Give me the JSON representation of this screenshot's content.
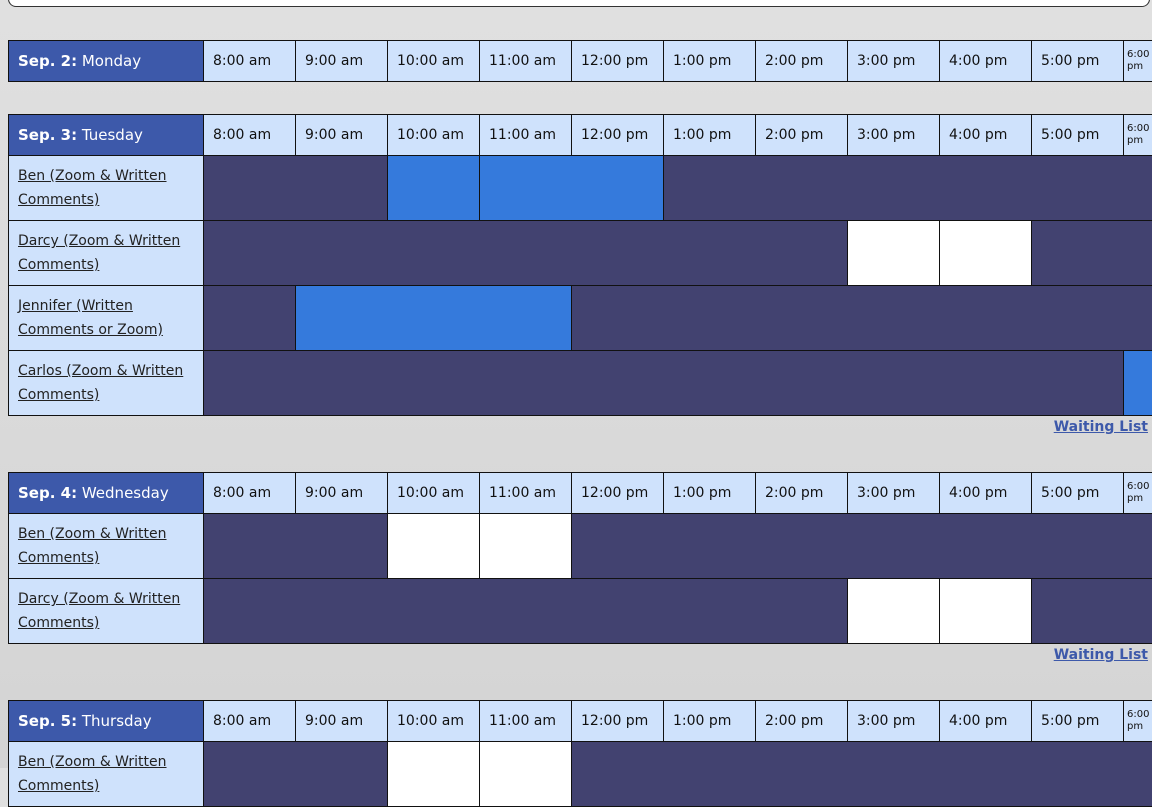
{
  "hours": [
    "8:00 am",
    "9:00 am",
    "10:00 am",
    "11:00 am",
    "12:00 pm",
    "1:00 pm",
    "2:00 pm",
    "3:00 pm",
    "4:00 pm",
    "5:00 pm",
    "6:00 pm"
  ],
  "colors": {
    "header": "#3d59aa",
    "hour_cell": "#cfe2fc",
    "booked": "#424270",
    "selected": "#357adc",
    "available": "#ffffff"
  },
  "waiting_list_label": "Waiting List",
  "days": [
    {
      "date": "Sep. 2:",
      "weekday": "Monday",
      "rows": [],
      "waiting_list": false
    },
    {
      "date": "Sep. 3:",
      "weekday": "Tuesday",
      "waiting_list": true,
      "rows": [
        {
          "name": "Ben (Zoom & Written Comments)",
          "cells": [
            {
              "status": "booked",
              "span": 2
            },
            {
              "status": "selected",
              "span": 1
            },
            {
              "status": "selected",
              "span": 2
            },
            {
              "status": "booked",
              "span": 6
            }
          ]
        },
        {
          "name": "Darcy (Zoom & Written Comments)",
          "cells": [
            {
              "status": "booked",
              "span": 7
            },
            {
              "status": "available",
              "span": 1
            },
            {
              "status": "available",
              "span": 1
            },
            {
              "status": "booked",
              "span": 2
            }
          ]
        },
        {
          "name": "Jennifer (Written Comments or Zoom)",
          "cells": [
            {
              "status": "booked",
              "span": 1
            },
            {
              "status": "selected",
              "span": 3
            },
            {
              "status": "booked",
              "span": 7
            }
          ]
        },
        {
          "name": "Carlos (Zoom & Written Comments)",
          "cells": [
            {
              "status": "booked",
              "span": 10
            },
            {
              "status": "selected",
              "span": 1
            }
          ]
        }
      ]
    },
    {
      "date": "Sep. 4:",
      "weekday": "Wednesday",
      "waiting_list": true,
      "rows": [
        {
          "name": "Ben (Zoom & Written Comments)",
          "cells": [
            {
              "status": "booked",
              "span": 2
            },
            {
              "status": "available",
              "span": 1
            },
            {
              "status": "available",
              "span": 1
            },
            {
              "status": "booked",
              "span": 7
            }
          ]
        },
        {
          "name": "Darcy (Zoom & Written Comments)",
          "cells": [
            {
              "status": "booked",
              "span": 7
            },
            {
              "status": "available",
              "span": 1
            },
            {
              "status": "available",
              "span": 1
            },
            {
              "status": "booked",
              "span": 2
            }
          ]
        }
      ]
    },
    {
      "date": "Sep. 5:",
      "weekday": "Thursday",
      "waiting_list": false,
      "rows": [
        {
          "name": "Ben (Zoom & Written Comments)",
          "cells": [
            {
              "status": "booked",
              "span": 2
            },
            {
              "status": "available",
              "span": 1
            },
            {
              "status": "available",
              "span": 1
            },
            {
              "status": "booked",
              "span": 7
            }
          ]
        }
      ]
    }
  ]
}
